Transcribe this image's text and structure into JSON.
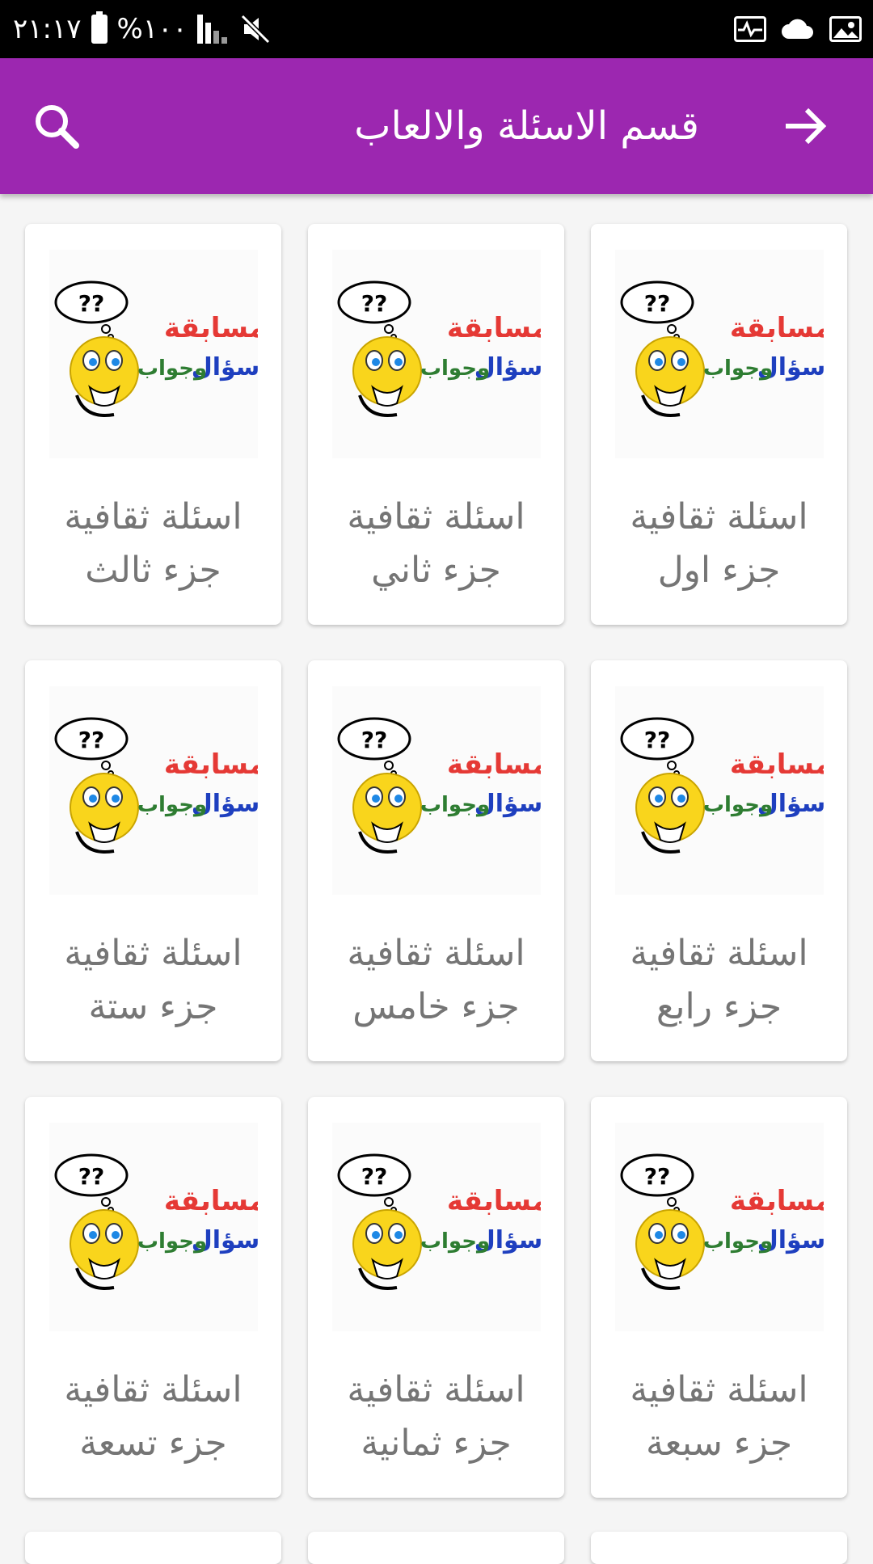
{
  "status_bar": {
    "time": "٢١:١٧",
    "battery": "%١٠٠"
  },
  "app_bar": {
    "title": "قسم الاسئلة والالعاب",
    "back_icon": "arrow-right-icon",
    "search_icon": "search-icon",
    "color": "#9c27b0"
  },
  "logo": {
    "line1": "مسابقة",
    "line2a": "سؤال",
    "line2b": "وجواب",
    "bubble": "??"
  },
  "cards": [
    {
      "line1": "اسئلة ثقافية",
      "line2": "جزء اول"
    },
    {
      "line1": "اسئلة ثقافية",
      "line2": "جزء ثاني"
    },
    {
      "line1": "اسئلة ثقافية",
      "line2": "جزء ثالث"
    },
    {
      "line1": "اسئلة ثقافية",
      "line2": "جزء رابع"
    },
    {
      "line1": "اسئلة ثقافية",
      "line2": "جزء خامس"
    },
    {
      "line1": "اسئلة ثقافية",
      "line2": "جزء ستة"
    },
    {
      "line1": "اسئلة ثقافية",
      "line2": "جزء سبعة"
    },
    {
      "line1": "اسئلة ثقافية",
      "line2": "جزء ثمانية"
    },
    {
      "line1": "اسئلة ثقافية",
      "line2": "جزء تسعة"
    }
  ]
}
